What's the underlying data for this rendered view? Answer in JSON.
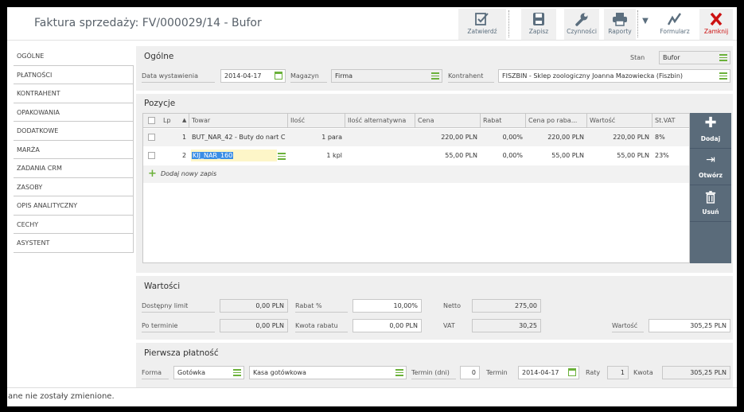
{
  "header": {
    "title": "Faktura sprzedaży: FV/000029/14 - Bufor",
    "toolbar": {
      "approve": "Zatwierdź",
      "save": "Zapisz",
      "actions": "Czynności",
      "reports": "Raporty",
      "forms": "Formularz",
      "close": "Zamknij"
    }
  },
  "nav": [
    "OGÓLNE",
    "PŁATNOŚCI",
    "KONTRAHENT",
    "OPAKOWANIA",
    "DODATKOWE",
    "MARŻA",
    "ZADANIA CRM",
    "ZASOBY",
    "OPIS ANALITYCZNY",
    "CECHY",
    "ASYSTENT"
  ],
  "general": {
    "title": "Ogólne",
    "status_label": "Stan",
    "status_value": "Bufor",
    "date_label": "Data wystawienia",
    "date_value": "2014-04-17",
    "warehouse_label": "Magazyn",
    "warehouse_value": "Firma",
    "contractor_label": "Kontrahent",
    "contractor_value": "FISZBIN - Sklep zoologiczny Joanna Mazowiecka  (Fiszbin)"
  },
  "positions": {
    "title": "Pozycje",
    "columns": {
      "lp": "Lp",
      "item": "Towar",
      "qty": "Ilość",
      "alt_qty": "Ilość alternatywna",
      "price": "Cena",
      "discount": "Rabat",
      "price_after": "Cena po raba...",
      "value": "Wartość",
      "vat": "St.VAT"
    },
    "rows": [
      {
        "lp": "1",
        "item": "BUT_NAR_42 - Buty do nart C...",
        "qty": "1 para",
        "alt_qty": "",
        "price": "220,00 PLN",
        "discount": "0,00%",
        "price_after": "220,00 PLN",
        "value": "220,00 PLN",
        "vat": "8%"
      },
      {
        "lp": "2",
        "item": "KIJ_NAR_160",
        "qty": "1 kpl",
        "alt_qty": "",
        "price": "55,00 PLN",
        "discount": "0,00%",
        "price_after": "55,00 PLN",
        "value": "55,00 PLN",
        "vat": "23%"
      }
    ],
    "add_new": "Dodaj nowy zapis",
    "side_buttons": {
      "add": "Dodaj",
      "open": "Otwórz",
      "delete": "Usuń"
    }
  },
  "values": {
    "title": "Wartości",
    "available_limit_label": "Dostępny limit",
    "available_limit_value": "0,00 PLN",
    "overdue_label": "Po terminie",
    "overdue_value": "0,00 PLN",
    "discount_pct_label": "Rabat %",
    "discount_pct_value": "10,00%",
    "discount_amount_label": "Kwota rabatu",
    "discount_amount_value": "0,00 PLN",
    "net_label": "Netto",
    "net_value": "275,00",
    "vat_label": "VAT",
    "vat_value": "30,25",
    "total_label": "Wartość",
    "total_value": "305,25 PLN"
  },
  "payment": {
    "title": "Pierwsza płatność",
    "form_label": "Forma",
    "form_value": "Gotówka",
    "cashbox_value": "Kasa gotówkowa",
    "term_days_label": "Termin (dni)",
    "term_days_value": "0",
    "term_label": "Termin",
    "term_value": "2014-04-17",
    "installments_label": "Raty",
    "installments_value": "1",
    "amount_label": "Kwota",
    "amount_value": "305,25 PLN"
  },
  "status_bar": "ane nie zostały zmienione.",
  "colors": {
    "accent_green": "#6bb13a",
    "panel": "#5a6b7a",
    "close_red": "#c11111"
  }
}
